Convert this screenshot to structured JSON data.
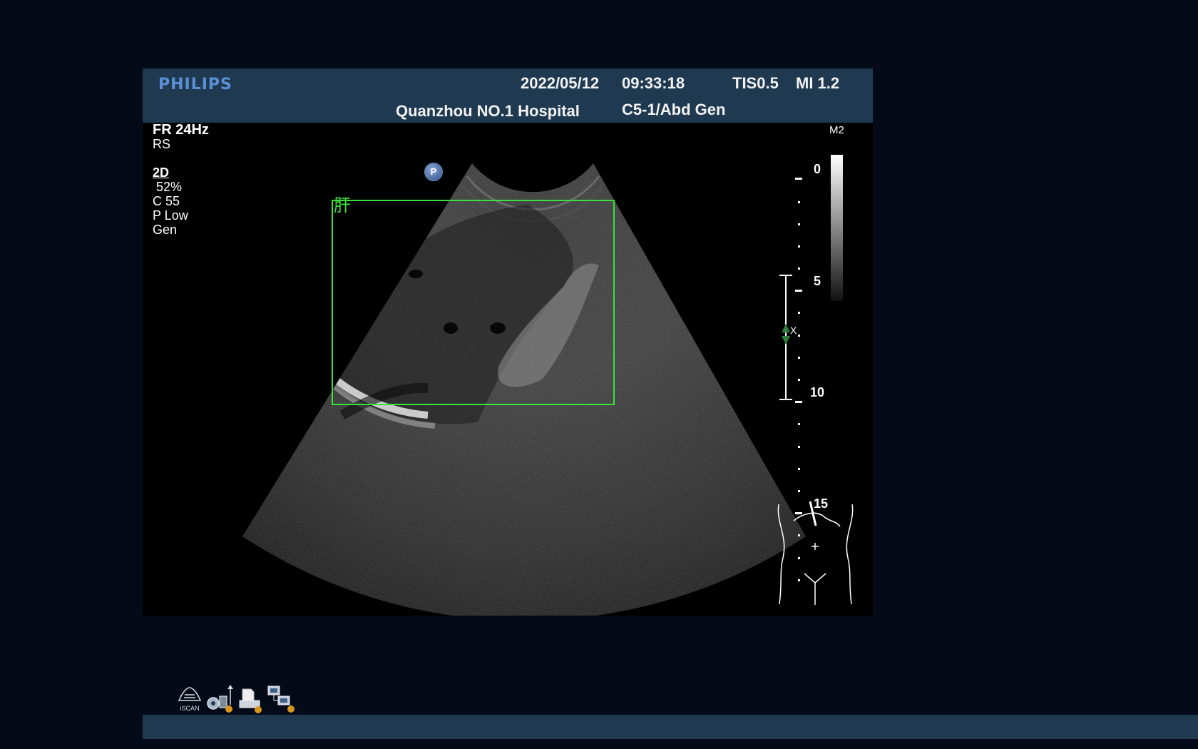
{
  "header": {
    "logo": "PHILIPS",
    "date": "2022/05/12",
    "time": "09:33:18",
    "tis": "TIS0.5",
    "mi": "MI 1.2",
    "hospital": "Quanzhou NO.1 Hospital",
    "probe_preset": "C5-1/Abd Gen"
  },
  "params": {
    "frame_rate": "FR 24Hz",
    "resolution": "RS",
    "mode": "2D",
    "gain": " 52%",
    "compression": "C 55",
    "power": "P Low",
    "optimization": "Gen"
  },
  "annotation": {
    "label": "肝",
    "label_color": "#39e23c",
    "badge": "P"
  },
  "depth_scale": {
    "map": "M2",
    "marks": [
      "0",
      "5",
      "10",
      "15"
    ],
    "focus_marker": "X"
  },
  "status_icons": [
    "iscan-icon",
    "usb-disk-icon",
    "print-icon",
    "network-icon"
  ],
  "status_icon_caption": "iSCAN",
  "colors": {
    "background": "#040a18",
    "header": "#1f3a50",
    "roi_box": "#39e23c",
    "logo": "#5b8fd6"
  }
}
